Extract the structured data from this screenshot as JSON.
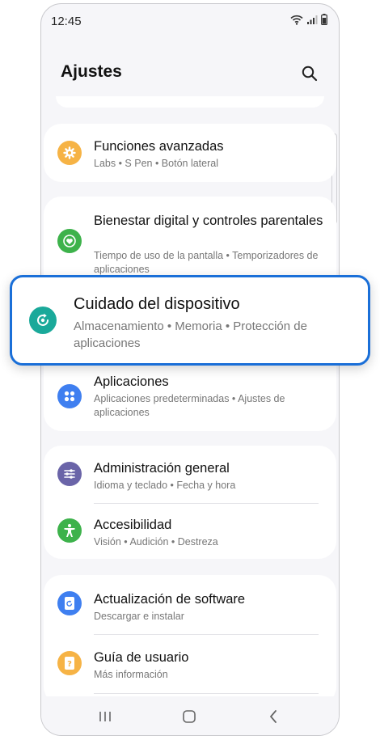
{
  "status_bar": {
    "time": "12:45"
  },
  "header": {
    "title": "Ajustes"
  },
  "items": {
    "funciones": {
      "title": "Funciones avanzadas",
      "subtitle": "Labs  •  S Pen  •  Botón lateral",
      "icon": "gear-icon",
      "color": "#f6b345"
    },
    "bienestar": {
      "title": "Bienestar digital y controles parentales",
      "subtitle": "Tiempo de uso de la pantalla  •  Temporizadores de aplicaciones",
      "icon": "heart-icon",
      "color": "#3db24b"
    },
    "cuidado": {
      "title": "Cuidado del dispositivo",
      "subtitle": "Almacenamiento  •  Memoria  •  Protección de aplicaciones",
      "icon": "refresh-icon",
      "color": "#1aa99a"
    },
    "aplicaciones": {
      "title": "Aplicaciones",
      "subtitle": "Aplicaciones predeterminadas  •  Ajustes de aplicaciones",
      "icon": "apps-icon",
      "color": "#3f7ff0"
    },
    "administracion": {
      "title": "Administración general",
      "subtitle": "Idioma y teclado  •  Fecha y hora",
      "icon": "sliders-icon",
      "color": "#6a64a8"
    },
    "accesibilidad": {
      "title": "Accesibilidad",
      "subtitle": "Visión  •  Audición  •  Destreza",
      "icon": "accessibility-icon",
      "color": "#3db24b"
    },
    "actualizacion": {
      "title": "Actualización de software",
      "subtitle": "Descargar e instalar",
      "icon": "update-icon",
      "color": "#3f7ff0"
    },
    "guia": {
      "title": "Guía de usuario",
      "subtitle": "Más información",
      "icon": "help-book-icon",
      "color": "#f6b345"
    }
  }
}
